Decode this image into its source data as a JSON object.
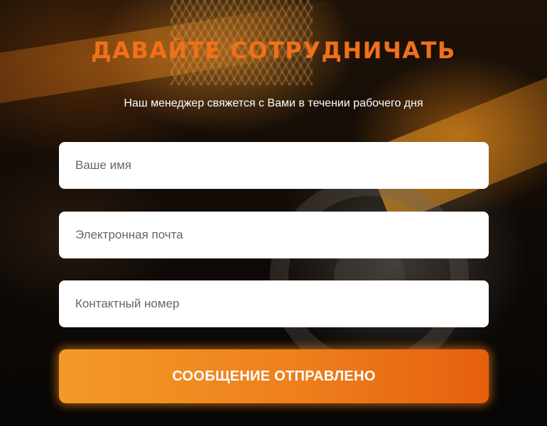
{
  "heading": "ДАВАЙТЕ СОТРУДНИЧАТЬ",
  "subtitle": "Наш менеджер свяжется с Вами в течении рабочего дня",
  "form": {
    "name_placeholder": "Ваше имя",
    "email_placeholder": "Электронная почта",
    "phone_placeholder": "Контактный номер",
    "submit_label": "СООБЩЕНИЕ ОТПРАВЛЕНО"
  },
  "colors": {
    "accent": "#f0701a",
    "button_start": "#f39a27",
    "button_end": "#e5600c",
    "field_bg": "#ffffff"
  }
}
